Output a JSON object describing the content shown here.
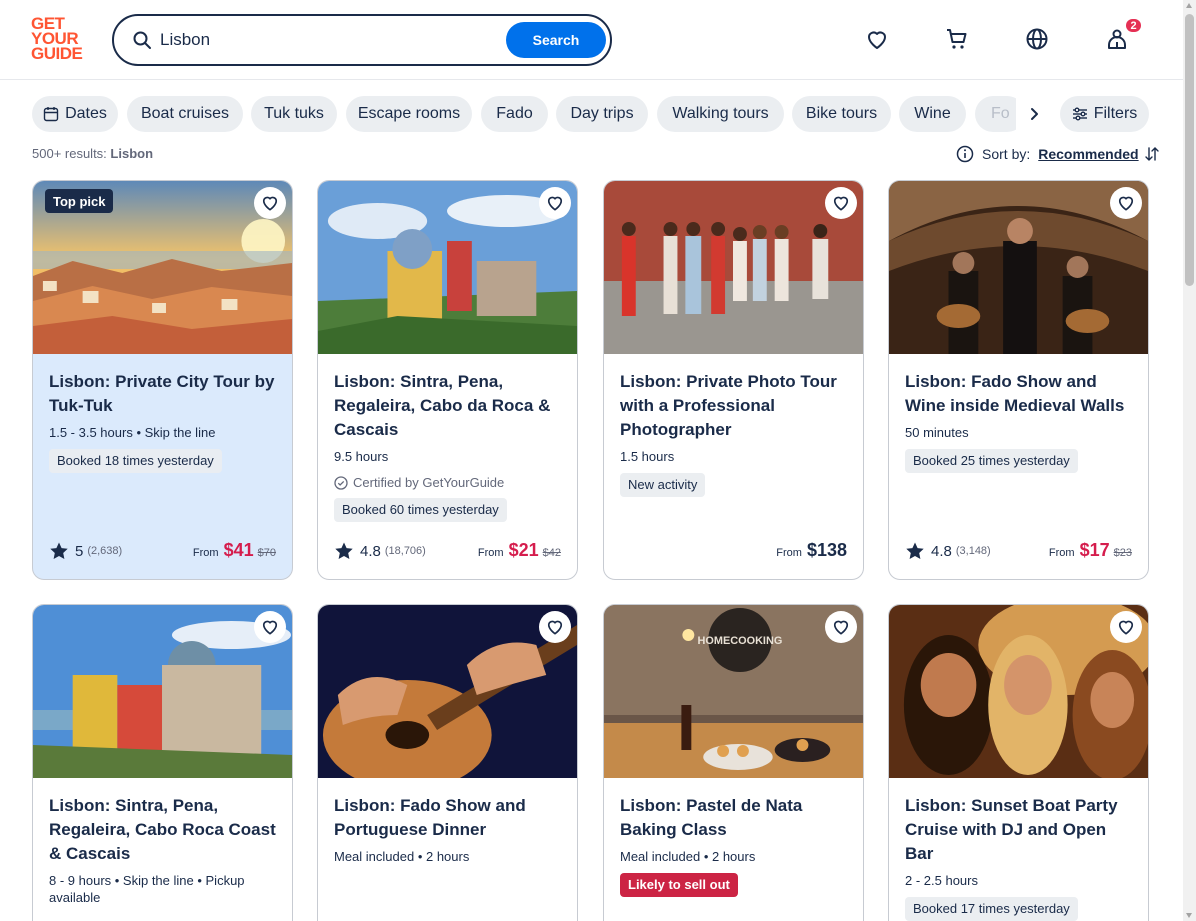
{
  "brand": {
    "logo_lines": [
      "GET",
      "YOUR",
      "GUIDE"
    ],
    "accent": "#ff5533"
  },
  "search": {
    "value": "Lisbon",
    "button_label": "Search"
  },
  "header_icons": [
    "heart-icon",
    "cart-icon",
    "globe-icon",
    "profile-icon"
  ],
  "notification_count": "2",
  "chips": [
    {
      "label": "Dates",
      "icon": "calendar-icon"
    },
    {
      "label": "Boat cruises"
    },
    {
      "label": "Tuk tuks"
    },
    {
      "label": "Escape rooms"
    },
    {
      "label": "Fado"
    },
    {
      "label": "Day trips"
    },
    {
      "label": "Walking tours"
    },
    {
      "label": "Bike tours"
    },
    {
      "label": "Wine"
    },
    {
      "label": "Fo"
    }
  ],
  "filters_label": "Filters",
  "results": {
    "count": "500+ results:",
    "query": "Lisbon"
  },
  "sort": {
    "label": "Sort by:",
    "value": "Recommended"
  },
  "cards": [
    {
      "title": "Lisbon: Private City Tour by Tuk-Tuk",
      "meta": "1.5 - 3.5 hours • Skip the line",
      "tag": "Booked 18 times yesterday",
      "badge": "Top pick",
      "rating": "5",
      "reviews": "(2,638)",
      "from": "From",
      "price": "$41",
      "old_price": "$70"
    },
    {
      "title": "Lisbon: Sintra, Pena, Regaleira, Cabo da Roca & Cascais",
      "meta": "9.5 hours",
      "certified": "Certified by GetYourGuide",
      "tag": "Booked 60 times yesterday",
      "rating": "4.8",
      "reviews": "(18,706)",
      "from": "From",
      "price": "$21",
      "old_price": "$42"
    },
    {
      "title": "Lisbon: Private Photo Tour with a Professional Photographer",
      "meta": "1.5 hours",
      "tag": "New activity",
      "from": "From",
      "price": "$138"
    },
    {
      "title": "Lisbon: Fado Show and Wine inside Medieval Walls",
      "meta": "50 minutes",
      "tag": "Booked 25 times yesterday",
      "rating": "4.8",
      "reviews": "(3,148)",
      "from": "From",
      "price": "$17",
      "old_price": "$23"
    },
    {
      "title": "Lisbon: Sintra, Pena, Regaleira, Cabo Roca Coast & Cascais",
      "meta": "8 - 9 hours • Skip the line • Pickup available"
    },
    {
      "title": "Lisbon: Fado Show and Portuguese Dinner",
      "meta": "Meal included • 2 hours"
    },
    {
      "title": "Lisbon: Pastel de Nata Baking Class",
      "meta": "Meal included • 2 hours",
      "tag": "Likely to sell out",
      "image_sign": "HOMECOOKING"
    },
    {
      "title": "Lisbon: Sunset Boat Party Cruise with DJ and Open Bar",
      "meta": "2 - 2.5 hours",
      "tag": "Booked 17 times yesterday"
    }
  ]
}
